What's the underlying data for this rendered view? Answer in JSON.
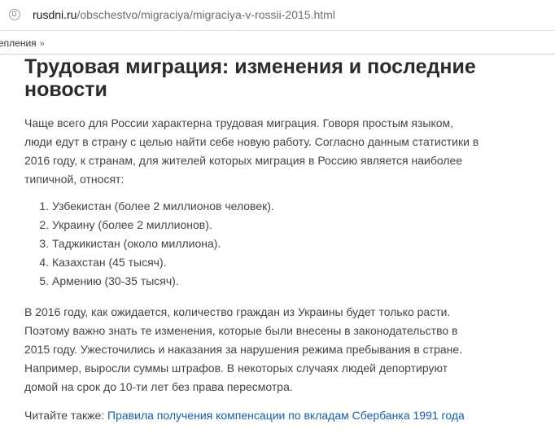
{
  "browser": {
    "url_domain": "rusdni.ru",
    "url_path": "/obschestvo/migraciya/migraciya-v-rossii-2015.html",
    "bookmark_label": "епления",
    "bookmark_arrow": "»"
  },
  "article": {
    "title": "Трудовая миграция: изменения и последние новости",
    "intro": "Чаще всего для России характерна трудовая миграция. Говоря простым языком, люди едут в страну с целью найти себе новую работу. Согласно данным статистики в 2016 году, к странам, для жителей которых миграция в Россию является наиболее типичной, относят:",
    "list": [
      "Узбекистан (более 2 миллионов человек).",
      "Украину (более 2 миллионов).",
      "Таджикистан (около миллиона).",
      "Казахстан (45 тысяч).",
      "Армению (30-35 тысяч)."
    ],
    "paragraph2": "В 2016 году, как ожидается, количество граждан из Украины будет только расти. Поэтому важно знать те изменения, которые были внесены в законодательство в 2015 году. Ужесточились и наказания за нарушения режима пребывания в стране. Например, выросли суммы штрафов. В некоторых случаях людей депортируют домой на срок до 10-ти лет без права пересмотра.",
    "read_also_label": "Читайте также:",
    "read_also_link": "Правила получения компенсации по вкладам Сбербанка 1991 года"
  }
}
